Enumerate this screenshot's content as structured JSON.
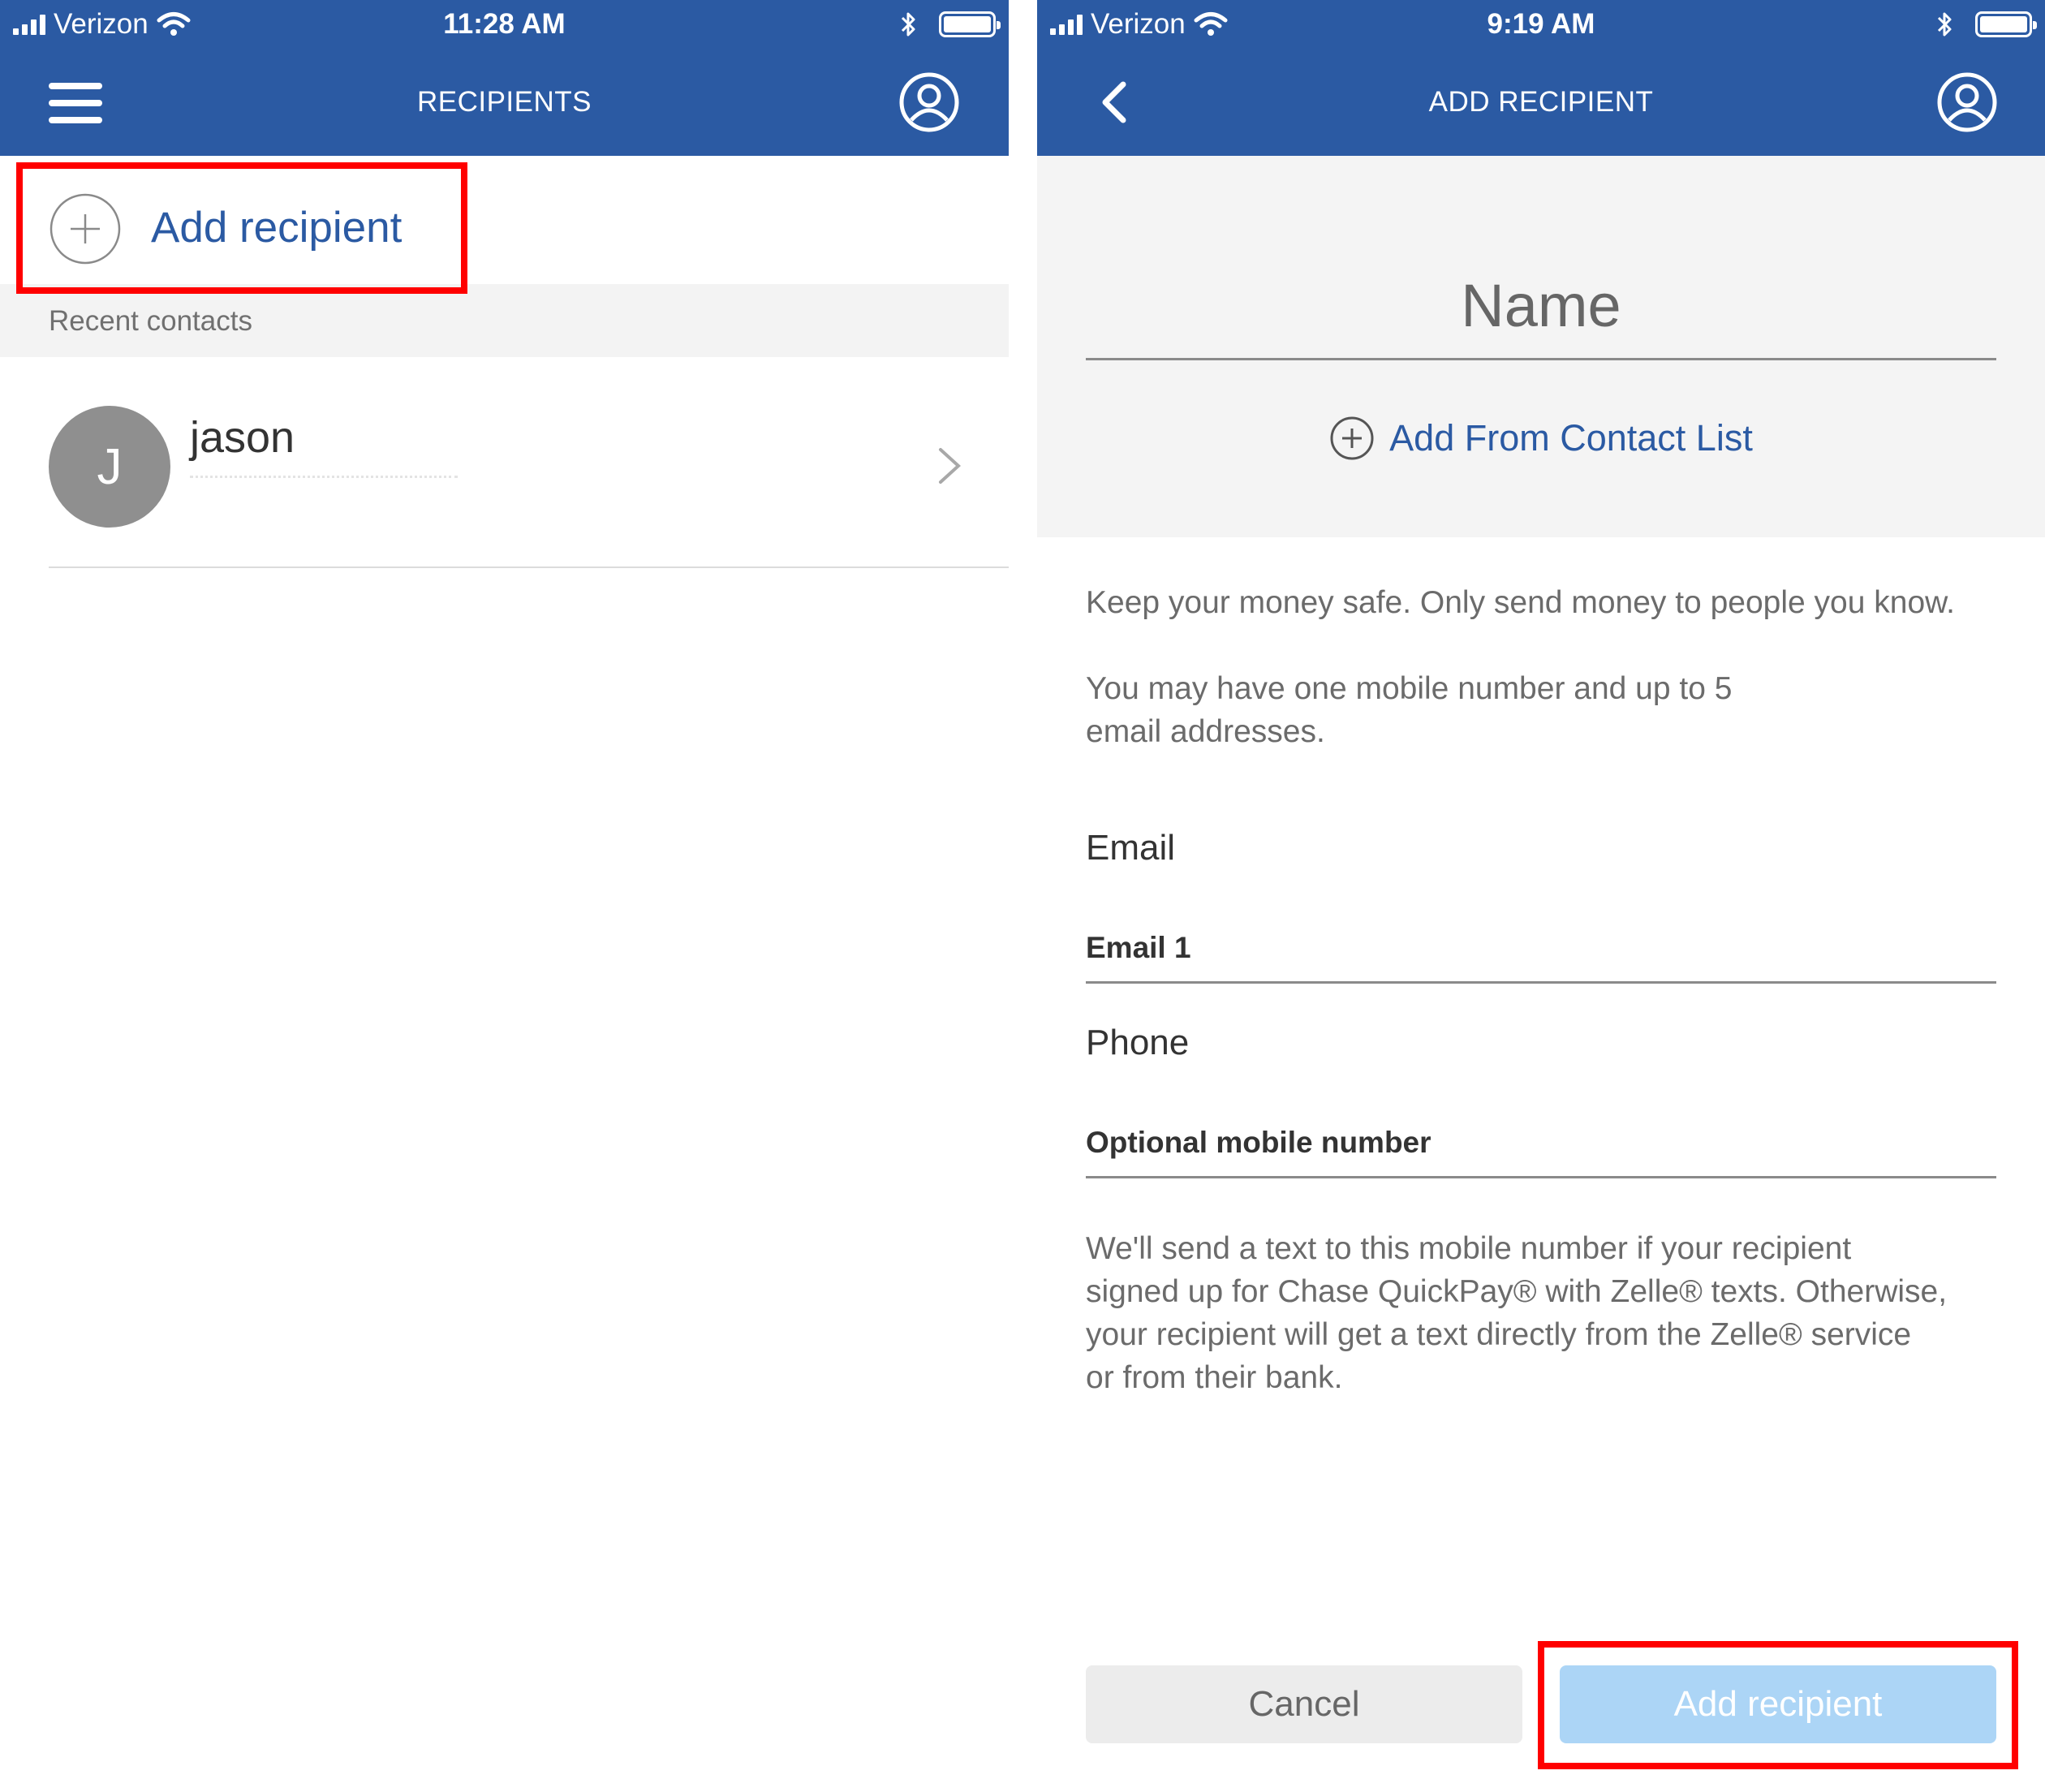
{
  "colors": {
    "header_bg": "#2b5aa3",
    "link_blue": "#2b5aa3",
    "highlight_red": "#ff0000",
    "disabled_button": "#acd5f6"
  },
  "left": {
    "status": {
      "carrier": "Verizon",
      "time": "11:28 AM"
    },
    "header": {
      "title": "RECIPIENTS",
      "menu_icon": "hamburger-menu-icon",
      "profile_icon": "profile-icon"
    },
    "add_recipient_label": "Add recipient",
    "recent_label": "Recent contacts",
    "contacts": [
      {
        "initial": "J",
        "name": "jason"
      }
    ]
  },
  "right": {
    "status": {
      "carrier": "Verizon",
      "time": "9:19 AM"
    },
    "header": {
      "title": "ADD RECIPIENT",
      "back_icon": "chevron-left-icon",
      "profile_icon": "profile-icon"
    },
    "name_placeholder": "Name",
    "add_from_contacts": "Add From Contact List",
    "safety_text": "Keep your money safe. Only send money to people you know.",
    "limit_text_line1": "You may have one mobile number and up to 5",
    "limit_text_line2": "email addresses.",
    "email_label": "Email",
    "email_placeholder": "Email 1",
    "phone_label": "Phone",
    "phone_placeholder": "Optional mobile number",
    "text_notice_lines": [
      "We'll send a text to this mobile number if your recipient",
      "signed up for Chase QuickPay® with Zelle® texts. Otherwise,",
      "your recipient will get a text directly from the Zelle® service",
      "or from their bank."
    ],
    "cancel_label": "Cancel",
    "add_button_label": "Add recipient"
  }
}
